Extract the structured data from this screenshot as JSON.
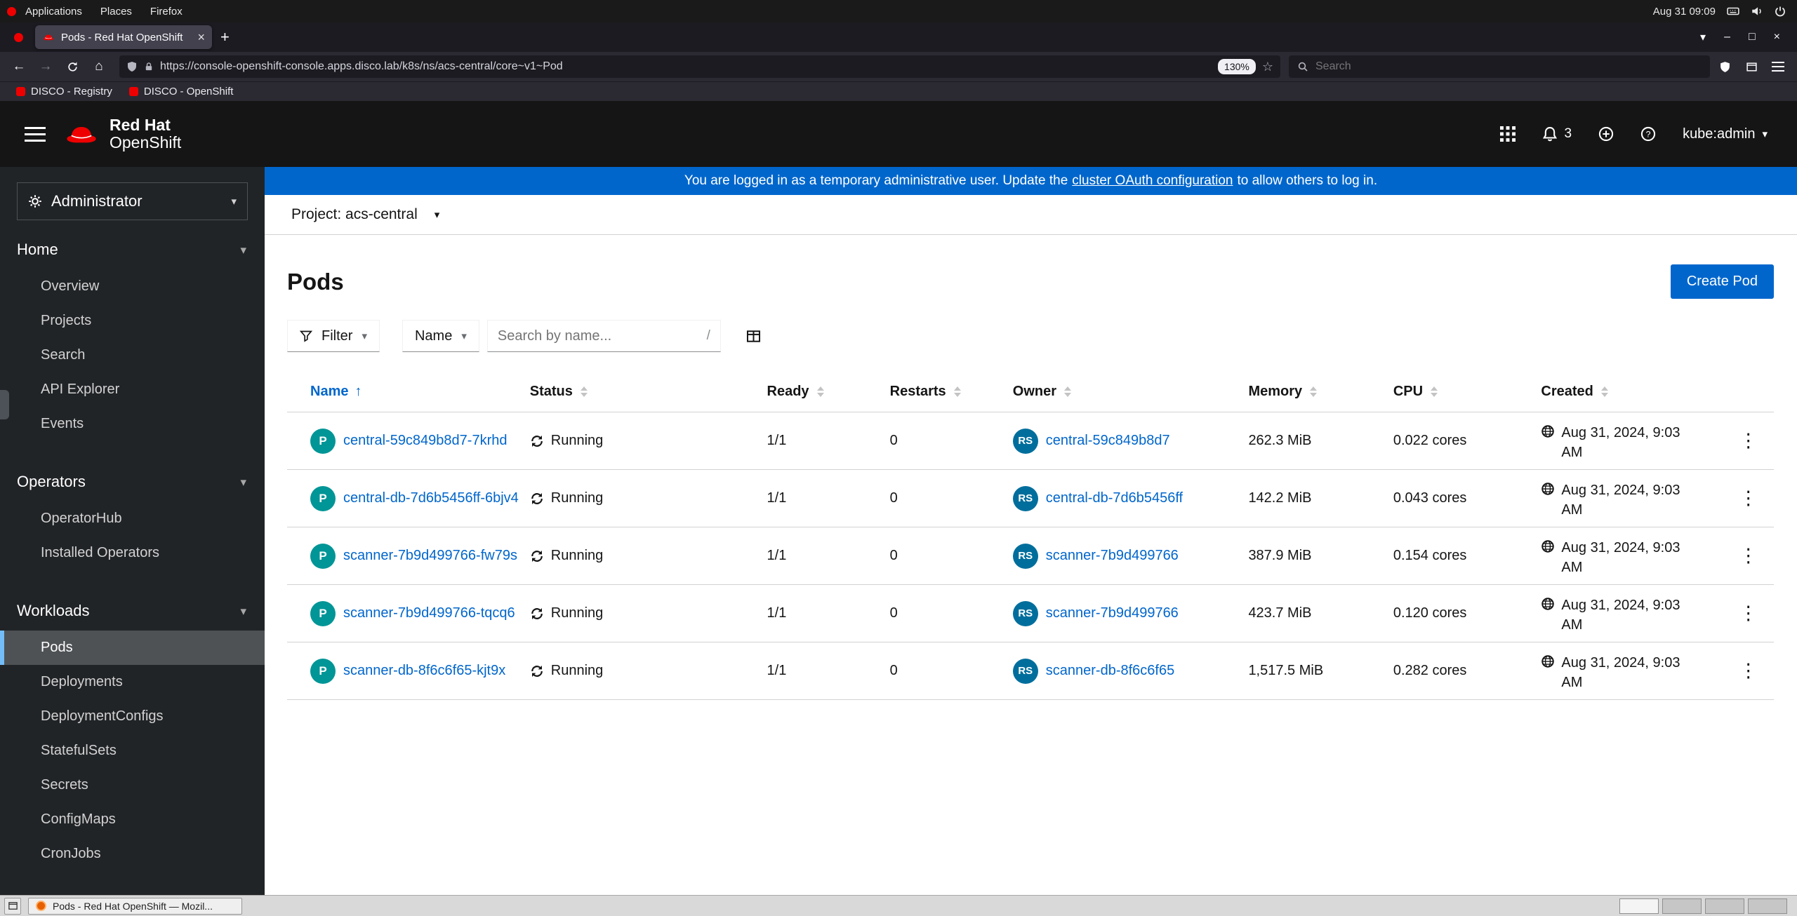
{
  "desktop_bar": {
    "menus": [
      "Applications",
      "Places",
      "Firefox"
    ],
    "clock": "Aug 31 09:09"
  },
  "browser": {
    "tab_title": "Pods - Red Hat OpenShift",
    "url": "https://console-openshift-console.apps.disco.lab/k8s/ns/acs-central/core~v1~Pod",
    "zoom": "130%",
    "search_placeholder": "Search",
    "bookmarks": [
      {
        "label": "DISCO - Registry"
      },
      {
        "label": "DISCO - OpenShift"
      }
    ]
  },
  "masthead": {
    "brand_top": "Red Hat",
    "brand_bottom": "OpenShift",
    "notification_count": "3",
    "username": "kube:admin"
  },
  "banner": {
    "text_before": "You are logged in as a temporary administrative user. Update the",
    "link_text": "cluster OAuth configuration",
    "text_after": "to allow others to log in."
  },
  "sidebar": {
    "perspective": "Administrator",
    "sections": [
      {
        "label": "Home",
        "items": [
          "Overview",
          "Projects",
          "Search",
          "API Explorer",
          "Events"
        ]
      },
      {
        "label": "Operators",
        "items": [
          "OperatorHub",
          "Installed Operators"
        ]
      },
      {
        "label": "Workloads",
        "items": [
          "Pods",
          "Deployments",
          "DeploymentConfigs",
          "StatefulSets",
          "Secrets",
          "ConfigMaps",
          "CronJobs"
        ]
      }
    ],
    "active_item": "Pods"
  },
  "project_bar": {
    "label": "Project: acs-central"
  },
  "page": {
    "title": "Pods",
    "create_button": "Create Pod"
  },
  "toolbar": {
    "filter_label": "Filter",
    "attribute_label": "Name",
    "search_placeholder": "Search by name...",
    "shortcut_hint": "/"
  },
  "pods_table": {
    "headers": [
      "Name",
      "Status",
      "Ready",
      "Restarts",
      "Owner",
      "Memory",
      "CPU",
      "Created"
    ],
    "badges": {
      "pod": "P",
      "replicaset": "RS"
    },
    "rows": [
      {
        "name": "central-59c849b8d7-7krhd",
        "status": "Running",
        "ready": "1/1",
        "restarts": "0",
        "owner": "central-59c849b8d7",
        "memory": "262.3 MiB",
        "cpu": "0.022 cores",
        "created": "Aug 31, 2024, 9:03 AM"
      },
      {
        "name": "central-db-7d6b5456ff-6bjv4",
        "status": "Running",
        "ready": "1/1",
        "restarts": "0",
        "owner": "central-db-7d6b5456ff",
        "memory": "142.2 MiB",
        "cpu": "0.043 cores",
        "created": "Aug 31, 2024, 9:03 AM"
      },
      {
        "name": "scanner-7b9d499766-fw79s",
        "status": "Running",
        "ready": "1/1",
        "restarts": "0",
        "owner": "scanner-7b9d499766",
        "memory": "387.9 MiB",
        "cpu": "0.154 cores",
        "created": "Aug 31, 2024, 9:03 AM"
      },
      {
        "name": "scanner-7b9d499766-tqcq6",
        "status": "Running",
        "ready": "1/1",
        "restarts": "0",
        "owner": "scanner-7b9d499766",
        "memory": "423.7 MiB",
        "cpu": "0.120 cores",
        "created": "Aug 31, 2024, 9:03 AM"
      },
      {
        "name": "scanner-db-8f6c6f65-kjt9x",
        "status": "Running",
        "ready": "1/1",
        "restarts": "0",
        "owner": "scanner-db-8f6c6f65",
        "memory": "1,517.5 MiB",
        "cpu": "0.282 cores",
        "created": "Aug 31, 2024, 9:03 AM"
      }
    ]
  },
  "taskbar": {
    "window_button": "Pods - Red Hat OpenShift — Mozil..."
  },
  "glyphs": {
    "caret_down": "▾",
    "sort_asc": "↑",
    "kebab": "⋮",
    "close": "×",
    "new_tab": "+",
    "list_tabs": "▾",
    "minimize": "–",
    "maximize": "□",
    "back": "←",
    "forward": "→",
    "home": "⌂",
    "star": "☆"
  },
  "colors": {
    "accent_blue": "#0066cc",
    "pod_badge": "#009596",
    "replicaset_badge": "#006e9c",
    "banner_blue": "#0066cc"
  }
}
